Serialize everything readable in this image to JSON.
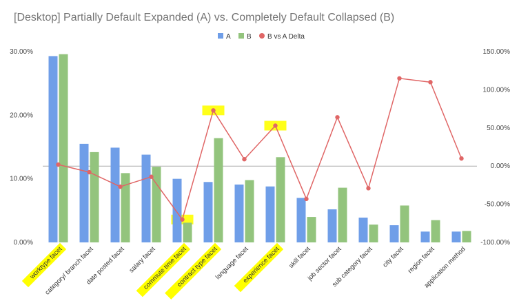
{
  "chart_data": {
    "type": "bar",
    "title": "[Desktop] Partially Default Expanded (A) vs. Completely Default Collapsed (B)",
    "categories": [
      "worktype facet",
      "category/ branch facet",
      "date posted facet",
      "salary facet",
      "commute time facet",
      "contract type facet",
      "language facet",
      "experience facet",
      "skill facet",
      "job sector facet",
      "sub category facet",
      "city facet",
      "region facet",
      "application method"
    ],
    "series": [
      {
        "name": "A",
        "kind": "bar",
        "axis": "left",
        "color": "#6f9ee8",
        "values": [
          29.3,
          15.5,
          14.9,
          13.8,
          10.0,
          9.5,
          9.1,
          8.8,
          7.0,
          5.2,
          3.9,
          2.7,
          1.7,
          1.7
        ]
      },
      {
        "name": "B",
        "kind": "bar",
        "axis": "left",
        "color": "#93c47d",
        "values": [
          29.6,
          14.2,
          10.9,
          11.9,
          3.1,
          16.4,
          9.8,
          13.4,
          4.0,
          8.6,
          2.8,
          5.8,
          3.5,
          1.8
        ]
      },
      {
        "name": "B vs A Delta",
        "kind": "line",
        "axis": "right",
        "color": "#e06666",
        "values": [
          2,
          -8,
          -27,
          -14,
          -70,
          73,
          9,
          53,
          -43,
          64,
          -29,
          115,
          110,
          10
        ]
      }
    ],
    "y_left": {
      "ylim": [
        0,
        32
      ],
      "ticks": [
        0,
        10,
        20,
        30
      ],
      "tick_labels": [
        "0.00%",
        "10.00%",
        "20.00%",
        "30.00%"
      ]
    },
    "y_right": {
      "ylim": [
        -100,
        160
      ],
      "ticks": [
        -100,
        -50,
        0,
        50,
        100,
        150
      ],
      "tick_labels": [
        "-100.00%",
        "-50.00%",
        "0.00%",
        "50.00%",
        "100.00%",
        "150.00%"
      ]
    },
    "legend": {
      "position": "top-center",
      "entries": [
        "A",
        "B",
        "B vs A Delta"
      ]
    },
    "grid": false,
    "zero_line_right_axis": true,
    "highlight_color": "#ffff00",
    "highlighted_categories": [
      0,
      4,
      5,
      7
    ],
    "highlighted_points": [
      4,
      5,
      7
    ]
  }
}
